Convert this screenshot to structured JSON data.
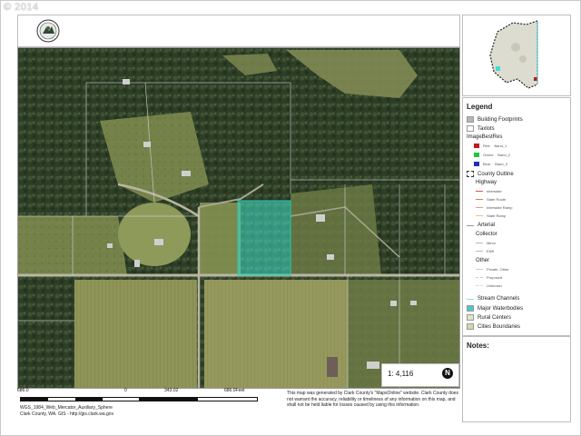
{
  "watermark": "© 2014",
  "legend": {
    "title": "Legend",
    "building_footprints": "Building Footprints",
    "taxlots": "Taxlots",
    "imagery": "ImageBestRes",
    "red": "Red:",
    "red_band": "Band_1",
    "green": "Green:",
    "green_band": "Band_2",
    "blue": "Blue:",
    "blue_band": "Band_3",
    "county_outline": "County Outline",
    "highway": "Highway",
    "interstate": "Interstate",
    "state_route": "State Route",
    "interstate_ramp": "Interstate Ramp",
    "state_ramp": "State Ramp",
    "arterial": "Arterial",
    "collector": "Collector",
    "minor": "Minor",
    "enr": "ENR",
    "other": "Other",
    "private_other": "Private, Other",
    "proposed": "Proposed",
    "unknown": "Unknown",
    "stream_channels": "Stream Channels",
    "major_waterbodies": "Major Waterbodies",
    "rural_centers": "Rural Centers",
    "cities_boundaries": "Cities Boundaries",
    "colors": {
      "building": "#b5b5b5",
      "red": "#c0191e",
      "green": "#1ec73a",
      "blue": "#1f2fb4",
      "interstate": "#d94d4d",
      "state_route": "#e07a4a",
      "interstate_ramp": "#e89a8a",
      "state_ramp": "#f0c08a",
      "arterial": "#999999",
      "minor": "#b7b7b7",
      "enr": "#9bd0a0",
      "stream": "#8fd6e3",
      "waterbody": "#4fc7cf",
      "rural_centers": "#e3e3c8",
      "cities": "#d6d6b0"
    }
  },
  "notes": {
    "title": "Notes:"
  },
  "scale": {
    "ratio": "1: 4,116",
    "left_label": "686.0",
    "zero_label": "0",
    "mid_label": "343.02",
    "right_label": "686.0Feet"
  },
  "footer": {
    "projection": "WGS_1984_Web_Mercator_Auxiliary_Sphere",
    "source": "Clark County, WA. GIS - http://gis.clark.wa.gov",
    "disclaimer": "This map was generated by Clark County's \"MapsOnline\" website. Clark County does not warrant the accuracy, reliability or timeliness of any information on this map, and shall not be held liable for losses caused by using this information."
  },
  "north_arrow": "N",
  "map": {
    "highlight_color": "#3fe0c8"
  }
}
